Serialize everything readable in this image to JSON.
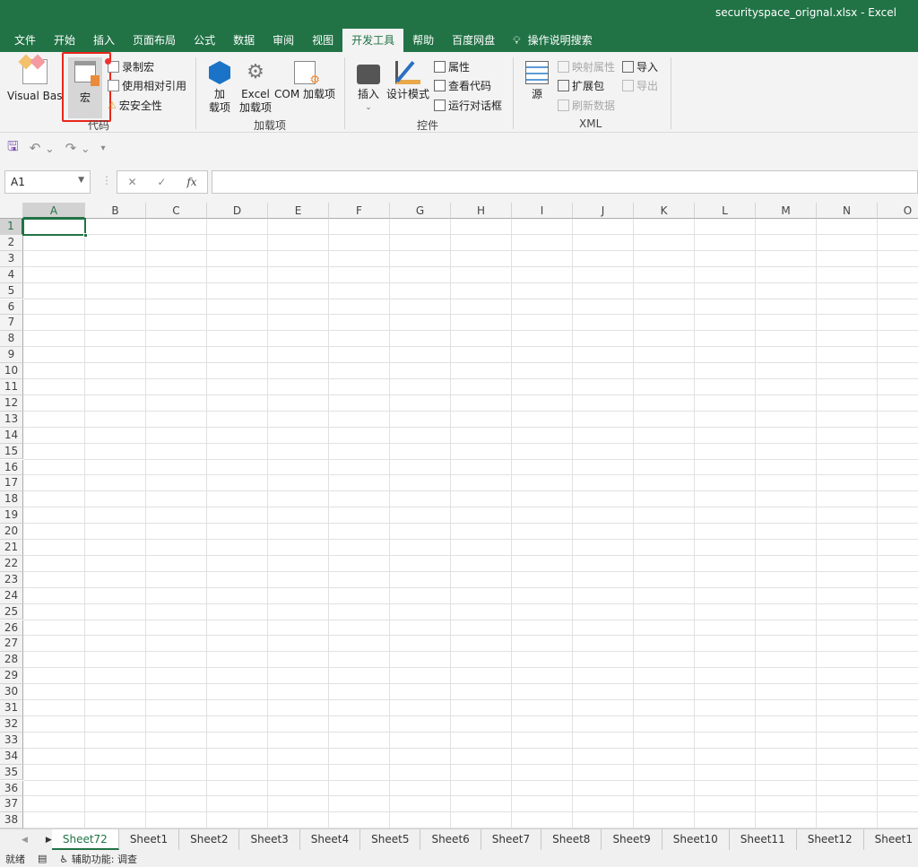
{
  "window": {
    "title": "securityspace_orignal.xlsx  -  Excel"
  },
  "tabs": [
    {
      "label": "文件"
    },
    {
      "label": "开始"
    },
    {
      "label": "插入"
    },
    {
      "label": "页面布局"
    },
    {
      "label": "公式"
    },
    {
      "label": "数据"
    },
    {
      "label": "审阅"
    },
    {
      "label": "视图"
    },
    {
      "label": "开发工具",
      "active": true
    },
    {
      "label": "帮助"
    },
    {
      "label": "百度网盘"
    },
    {
      "label": "操作说明搜索"
    }
  ],
  "ribbon": {
    "code": {
      "label": "代码",
      "visual_basic": "Visual Basic",
      "macros": "宏",
      "record": "录制宏",
      "relative": "使用相对引用",
      "security": "宏安全性"
    },
    "addins": {
      "label": "加载项",
      "addins_line1": "加",
      "addins_line2": "载项",
      "excel_line1": "Excel",
      "excel_line2": "加载项",
      "com": "COM 加载项"
    },
    "controls": {
      "label": "控件",
      "insert": "插入",
      "design": "设计模式",
      "properties": "属性",
      "view_code": "查看代码",
      "run_dialog": "运行对话框"
    },
    "xml": {
      "label": "XML",
      "source": "源",
      "map_props": "映射属性",
      "expansion": "扩展包",
      "refresh": "刷新数据",
      "import": "导入",
      "export": "导出"
    }
  },
  "formula_bar": {
    "name_box": "A1",
    "fx": "fx",
    "value": ""
  },
  "grid": {
    "columns": [
      "A",
      "B",
      "C",
      "D",
      "E",
      "F",
      "G",
      "H",
      "I",
      "J",
      "K",
      "L",
      "M",
      "N",
      "O"
    ],
    "row_count": 38,
    "selected": "A1"
  },
  "sheets": [
    {
      "name": "Sheet72",
      "active": true
    },
    {
      "name": "Sheet1"
    },
    {
      "name": "Sheet2"
    },
    {
      "name": "Sheet3"
    },
    {
      "name": "Sheet4"
    },
    {
      "name": "Sheet5"
    },
    {
      "name": "Sheet6"
    },
    {
      "name": "Sheet7"
    },
    {
      "name": "Sheet8"
    },
    {
      "name": "Sheet9"
    },
    {
      "name": "Sheet10"
    },
    {
      "name": "Sheet11"
    },
    {
      "name": "Sheet12"
    },
    {
      "name": "Sheet1"
    }
  ],
  "status": {
    "ready": "就绪",
    "accessibility": "辅助功能: 调查"
  },
  "colors": {
    "brand": "#217346",
    "highlight": "#e8261b"
  }
}
